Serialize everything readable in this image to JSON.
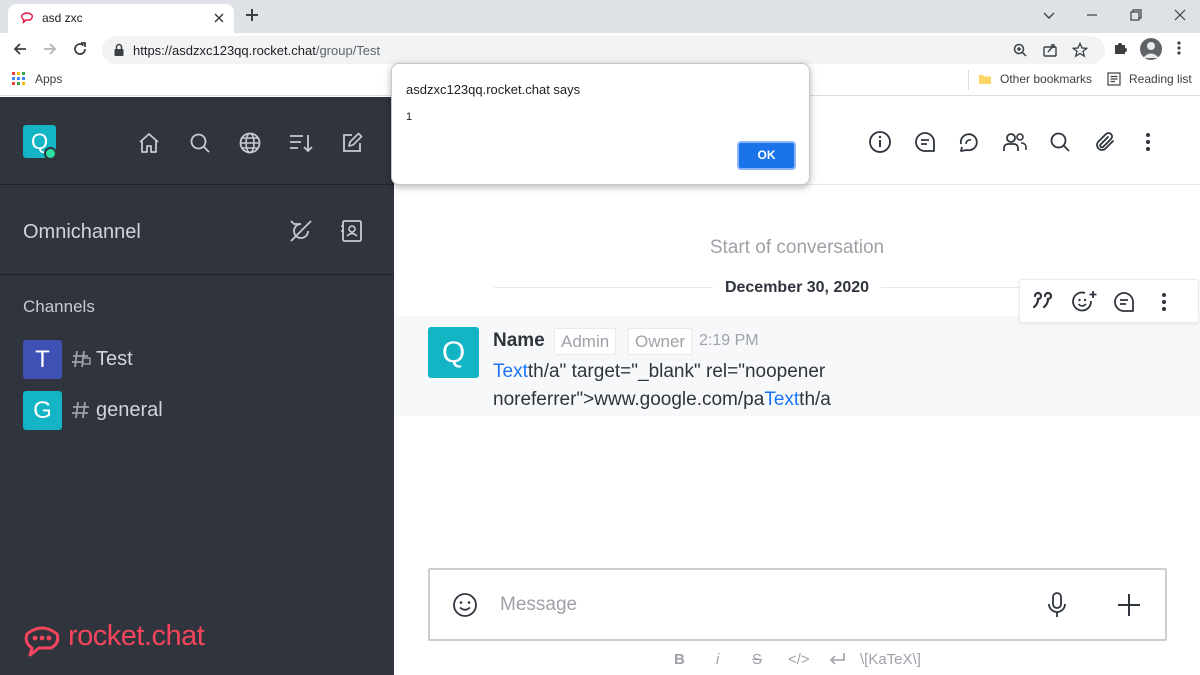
{
  "browser": {
    "tab_title": "asd zxc",
    "url_host": "https://asdzxc123qq.rocket.chat",
    "url_path": "/group/Test",
    "bookmarks": {
      "apps": "Apps",
      "other": "Other bookmarks",
      "reading_list": "Reading list"
    }
  },
  "dialog": {
    "title": "asdzxc123qq.rocket.chat says",
    "message": "1",
    "ok_label": "OK"
  },
  "sidebar": {
    "user_initial": "Q",
    "omnichannel_label": "Omnichannel",
    "channels_title": "Channels",
    "channels": [
      {
        "initial": "T",
        "name": "Test",
        "color": "#3f51b5",
        "icon": "private-hash-icon"
      },
      {
        "initial": "G",
        "name": "general",
        "color": "#13b4c4",
        "icon": "hash-icon"
      }
    ],
    "brand": "rocket.chat"
  },
  "room": {
    "start_text": "Start of conversation",
    "date": "December 30, 2020",
    "message": {
      "avatar_initial": "Q",
      "author": "Name",
      "roles": [
        "Admin",
        "Owner"
      ],
      "time": "2:19 PM",
      "body_link1": "Text",
      "body_part1": "th/a\" target=\"_blank\" rel=\"noopener noreferrer\">www.google.com/pa",
      "body_link2": "Text",
      "body_part2": "th/a"
    },
    "composer_placeholder": "Message",
    "format_toolbar": {
      "bold": "B",
      "italic": "i",
      "strike": "S",
      "code": "</>",
      "katex": "\\[KaTeX\\]"
    }
  },
  "colors": {
    "sidebar_bg": "#2f343d",
    "accent": "#1d74f5",
    "brand_red": "#f5455c",
    "dialog_button": "#1a73e8"
  }
}
